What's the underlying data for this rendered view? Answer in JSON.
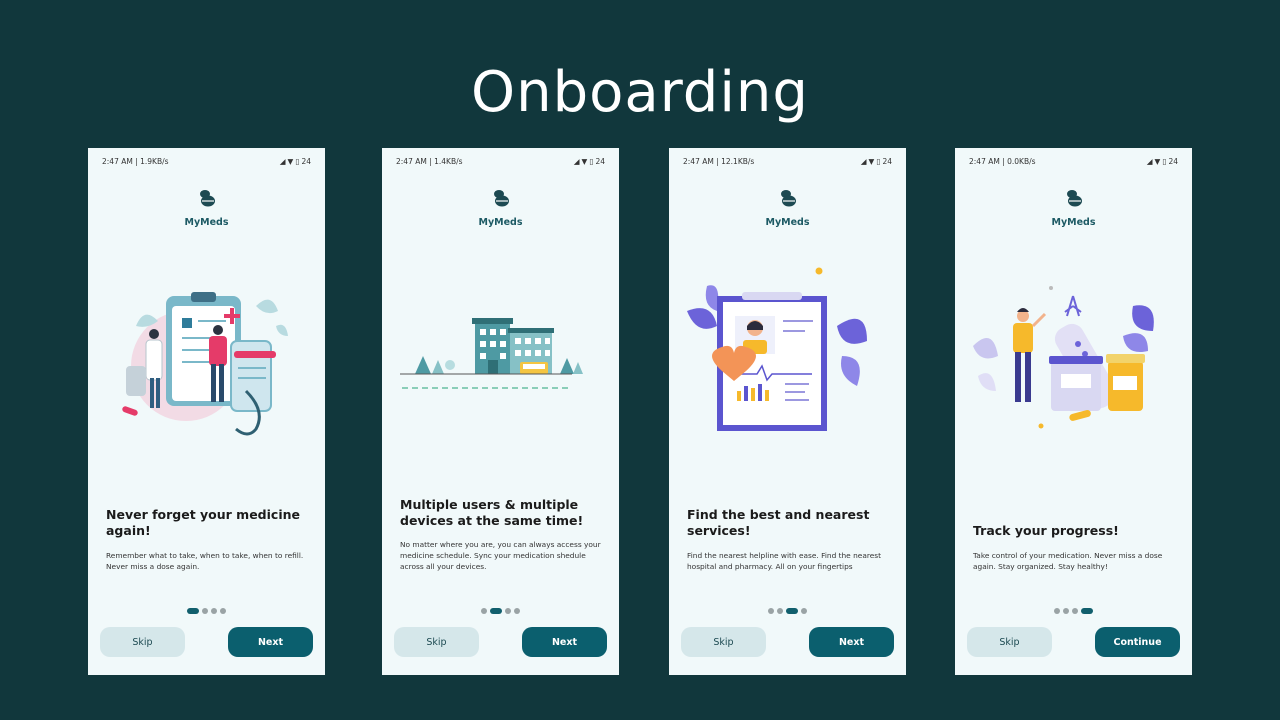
{
  "page": {
    "title": "Onboarding"
  },
  "screens": [
    {
      "status": {
        "time": "2:47 AM | 1.9KB/s",
        "battery": "24"
      },
      "app_name": "MyMeds",
      "headline": "Never forget your medicine again!",
      "body": "Remember what to take, when to take, when to refill. Never miss a dose again.",
      "active_dot": 0,
      "skip_label": "Skip",
      "primary_label": "Next",
      "illustration": "doctor-patient-clipboard-illustration"
    },
    {
      "status": {
        "time": "2:47 AM | 1.4KB/s",
        "battery": "24"
      },
      "app_name": "MyMeds",
      "headline": "Multiple users & multiple devices at the same time!",
      "body": "No matter where you are, you can always access your medicine schedule. Sync your medication shedule across all your devices.",
      "active_dot": 1,
      "skip_label": "Skip",
      "primary_label": "Next",
      "illustration": "hospital-building-illustration"
    },
    {
      "status": {
        "time": "2:47 AM | 12.1KB/s",
        "battery": "24"
      },
      "app_name": "MyMeds",
      "headline": "Find the best and nearest services!",
      "body": "Find the nearest helpline with ease. Find the nearest hospital and pharmacy. All on your fingertips",
      "active_dot": 2,
      "skip_label": "Skip",
      "primary_label": "Next",
      "illustration": "doctor-profile-clipboard-illustration"
    },
    {
      "status": {
        "time": "2:47 AM | 0.0KB/s",
        "battery": "24"
      },
      "app_name": "MyMeds",
      "headline": "Track your progress!",
      "body": "Take control of your medication. Never miss a dose again. Stay organized. Stay healthy!",
      "active_dot": 3,
      "skip_label": "Skip",
      "primary_label": "Continue",
      "illustration": "person-with-pill-bottles-illustration"
    }
  ],
  "colors": {
    "background": "#11373c",
    "screen": "#f1f9fa",
    "brand": "#0b5f6e",
    "skip_button": "#d5e7ea",
    "dot_inactive": "#9aa3a5"
  }
}
